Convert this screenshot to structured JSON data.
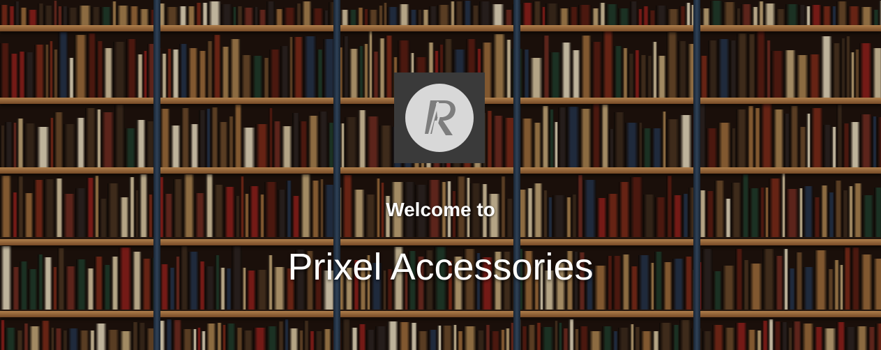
{
  "hero": {
    "logo_icon": "prixel-logo-icon",
    "welcome_text": "Welcome to",
    "title": "Prixel Accessories"
  },
  "colors": {
    "text": "#ffffff",
    "logo_bg": "#3a3a3a",
    "logo_circle": "#d8d8d8",
    "logo_letter": "#808080",
    "wood": "#c88a4e"
  },
  "background": {
    "image_icon": "bookshelf-background",
    "book_colors": [
      "#5a1d12",
      "#7a2a18",
      "#3b2a1c",
      "#a9824f",
      "#d9c7a2",
      "#1f3b2a",
      "#6b4a2a",
      "#8c1f1a",
      "#2b2320",
      "#c4a878",
      "#4a3420",
      "#9b6b3a",
      "#e6d9bc",
      "#243248",
      "#6e2b20"
    ]
  }
}
